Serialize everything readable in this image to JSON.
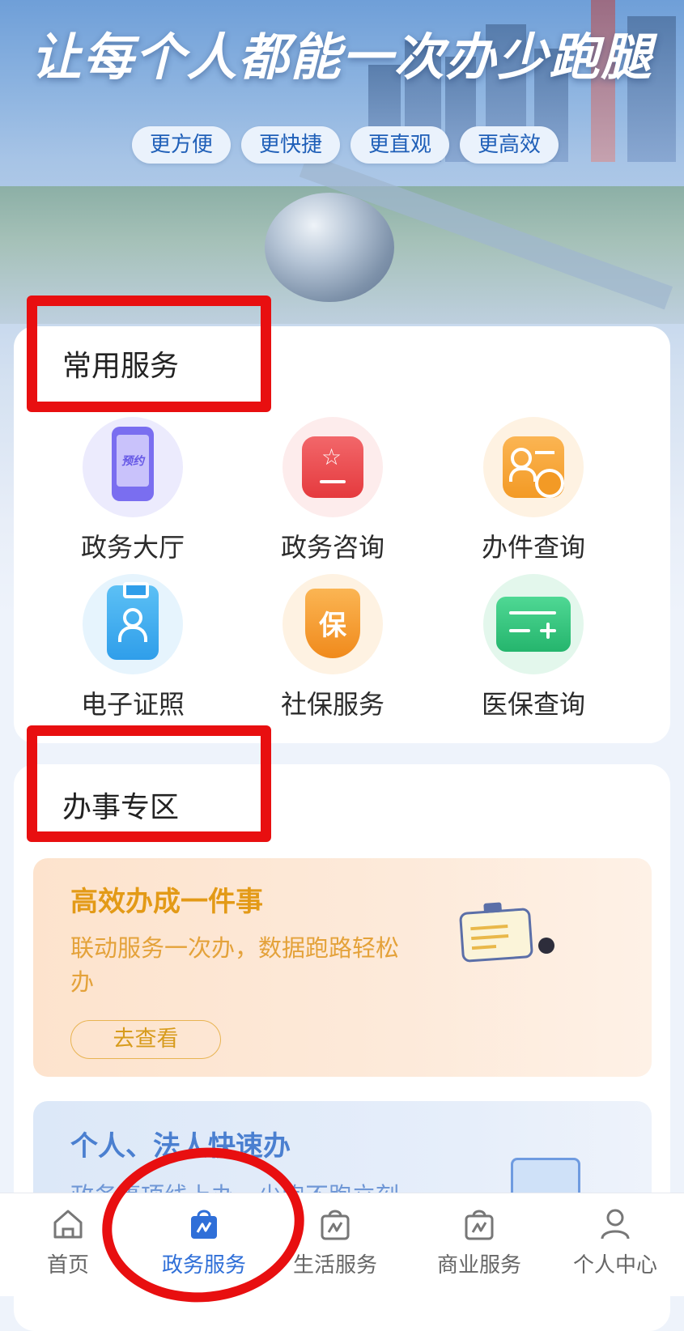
{
  "hero": {
    "slogan": "让每个人都能一次办少跑腿",
    "tags": [
      "更方便",
      "更快捷",
      "更直观",
      "更高效"
    ]
  },
  "common_services": {
    "title": "常用服务",
    "items": [
      {
        "label": "政务大厅",
        "icon": "phone-appointment-icon",
        "icon_text": "预约",
        "color": "#7a6ef0"
      },
      {
        "label": "政务咨询",
        "icon": "star-document-icon",
        "color": "#ea4b4f"
      },
      {
        "label": "办件查询",
        "icon": "person-clock-icon",
        "color": "#f6a33b"
      },
      {
        "label": "电子证照",
        "icon": "id-badge-icon",
        "color": "#37a6ef"
      },
      {
        "label": "社保服务",
        "icon": "shield-bao-icon",
        "icon_text": "保",
        "color": "#f39a25"
      },
      {
        "label": "医保查询",
        "icon": "medical-card-icon",
        "color": "#2fc27c"
      }
    ]
  },
  "affairs": {
    "title": "办事专区",
    "panel1": {
      "title": "高效办成一件事",
      "desc_line1": "联动服务一次办，数据跑路轻松",
      "desc_line2": "办",
      "button": "去查看"
    },
    "panel2": {
      "title": "个人、法人快速办",
      "desc": "政务事项线上办，少跑不跑立刻"
    }
  },
  "tabbar": {
    "items": [
      {
        "label": "首页",
        "icon": "home-icon"
      },
      {
        "label": "政务服务",
        "icon": "gov-service-bag-icon",
        "active": true
      },
      {
        "label": "生活服务",
        "icon": "life-service-bag-icon"
      },
      {
        "label": "商业服务",
        "icon": "business-service-bag-icon"
      },
      {
        "label": "个人中心",
        "icon": "user-icon"
      }
    ]
  },
  "colors": {
    "accent": "#2f6fd8",
    "annotation_red": "#e80f10",
    "orange_text": "#e39a17",
    "blue_text": "#4a7fd0"
  }
}
